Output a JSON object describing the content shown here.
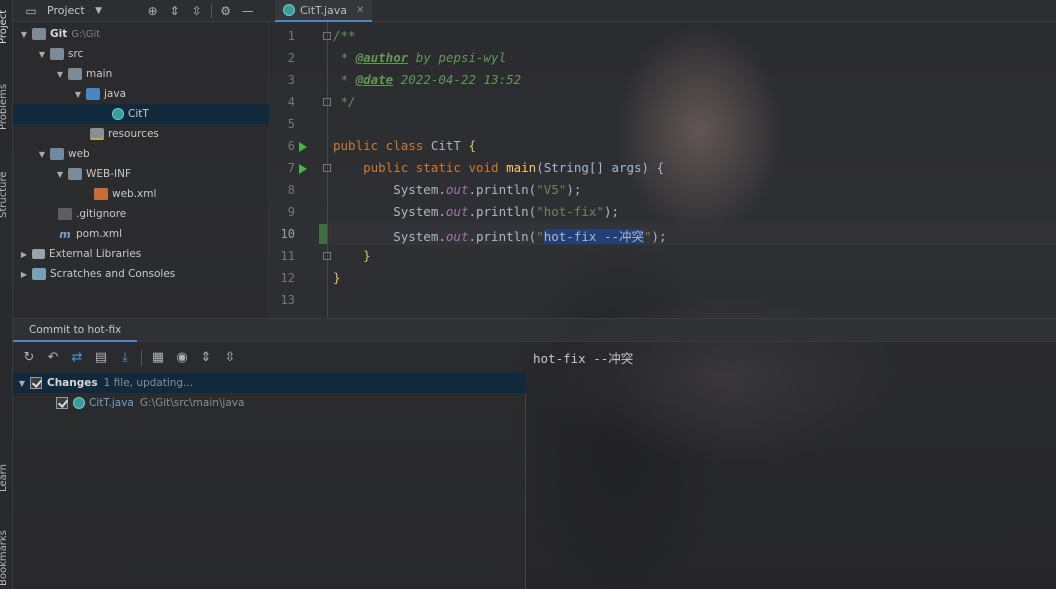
{
  "left_strip": {
    "tabs": [
      "Project",
      "Problems",
      "Structure",
      "Learn",
      "Bookmarks"
    ]
  },
  "project_toolbar": {
    "title": "Project"
  },
  "project_tree": [
    {
      "label": "Git",
      "sub": "G:\\Git",
      "icon": "folder-icon"
    },
    {
      "label": "src",
      "sub": "",
      "icon": "folder-icon"
    },
    {
      "label": "main",
      "sub": "",
      "icon": "folder-icon"
    },
    {
      "label": "java",
      "sub": "",
      "icon": "source-folder-icon"
    },
    {
      "label": "CitT",
      "sub": "",
      "icon": "java-class-icon"
    },
    {
      "label": "resources",
      "sub": "",
      "icon": "resources-folder-icon"
    },
    {
      "label": "web",
      "sub": "",
      "icon": "web-folder-icon"
    },
    {
      "label": "WEB-INF",
      "sub": "",
      "icon": "folder-icon"
    },
    {
      "label": "web.xml",
      "sub": "",
      "icon": "xml-file-icon"
    },
    {
      "label": ".gitignore",
      "sub": "",
      "icon": "gitignore-file-icon"
    },
    {
      "label": "pom.xml",
      "sub": "",
      "icon": "maven-icon"
    },
    {
      "label": "External Libraries",
      "sub": "",
      "icon": "library-icon"
    },
    {
      "label": "Scratches and Consoles",
      "sub": "",
      "icon": "scratches-icon"
    }
  ],
  "editor": {
    "tab_label": "CitT.java",
    "line_numbers": [
      "1",
      "2",
      "3",
      "4",
      "5",
      "6",
      "7",
      "8",
      "9",
      "10",
      "11",
      "12",
      "13"
    ],
    "lines": {
      "l1": "/**",
      "l2_star": " * ",
      "l2_tag": "@author",
      "l2_rest": " by pepsi-wyl",
      "l3_star": " * ",
      "l3_tag": "@date",
      "l3_rest": " 2022-04-22 13:52",
      "l4": " */",
      "l6_kw": "public class ",
      "l6_name": "CitT ",
      "l6_brace": "{",
      "l7_kw": "    public static void ",
      "l7_fn": "main",
      "l7_rest": "(String[] args) {",
      "l8_a": "        System.",
      "l8_field": "out",
      "l8_b": ".println(",
      "l8_str": "\"V5\"",
      "l8_end": ");",
      "l9_a": "        System.",
      "l9_field": "out",
      "l9_b": ".println(",
      "l9_str": "\"hot-fix\"",
      "l9_end": ");",
      "l10_a": "        System.",
      "l10_field": "out",
      "l10_b": ".println(",
      "l10_str_open": "\"",
      "l10_sel": "hot-fix --冲突",
      "l10_str_close": "\"",
      "l10_end": ");",
      "l11": "    }",
      "l12": "}"
    }
  },
  "commit": {
    "tab_label": "Commit to hot-fix",
    "changes_label": "Changes",
    "changes_status": "1 file, updating...",
    "file_name": "CitT.java",
    "file_path": "G:\\Git\\src\\main\\java",
    "message": "hot-fix --冲突"
  },
  "colors": {
    "accent": "#4a88c7",
    "selection": "#0d293e",
    "keyword": "#cc7832",
    "string": "#6a8759",
    "comment": "#629755"
  }
}
